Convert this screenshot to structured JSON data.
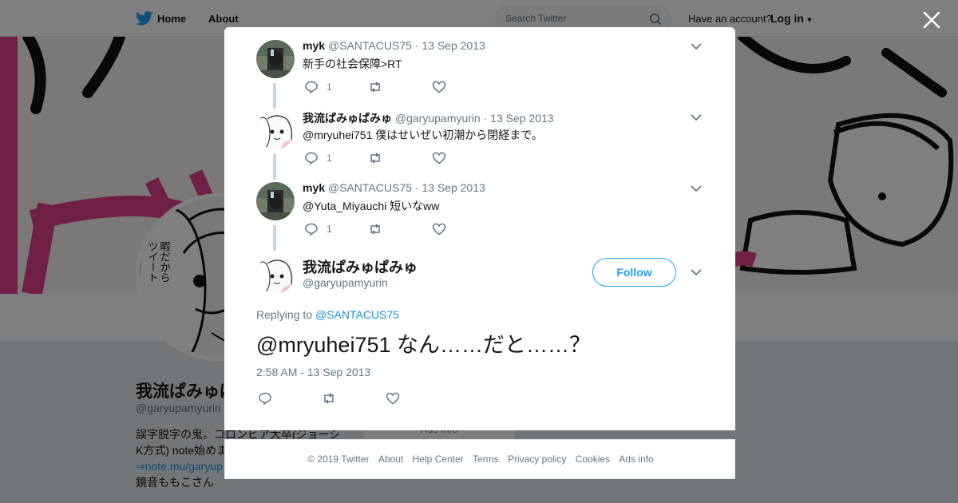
{
  "topbar": {
    "home_label": "Home",
    "about_label": "About",
    "search_placeholder": "Search Twitter",
    "have_account": "Have an account?",
    "login_label": "Log in"
  },
  "profile": {
    "name": "我流ぱみゅぱみゅ",
    "handle": "@garyupamyurin",
    "bio_line1": "誤字脱字の鬼。コロンビア大卒(ジョーシ",
    "bio_line2": "K方式) note始めま",
    "bio_link": "⇒note.mu/garyup",
    "bio_line4": "鏡音ももこさん",
    "card_text": "Ads info"
  },
  "thread": [
    {
      "name": "myk",
      "handle": "@SANTACUS75",
      "date": "13 Sep 2013",
      "text": "新手の社会保障>RT",
      "reply_count": "1",
      "avatar": "photo-avatar"
    },
    {
      "name": "我流ぱみゅぱみゅ",
      "handle": "@garyupamyurin",
      "date": "13 Sep 2013",
      "text": "@mryuhei751 僕はせいぜい初潮から閉経まで。",
      "reply_count": "1",
      "avatar": "manga-avatar"
    },
    {
      "name": "myk",
      "handle": "@SANTACUS75",
      "date": "13 Sep 2013",
      "text": "@Yuta_Miyauchi 短いなww",
      "reply_count": "1",
      "avatar": "photo-avatar"
    }
  ],
  "main_tweet": {
    "name": "我流ぱみゅぱみゅ",
    "handle": "@garyupamyurin",
    "follow_label": "Follow",
    "replying_prefix": "Replying to",
    "replying_to": "@SANTACUS75",
    "text": "@mryuhei751 なん……だと……？",
    "timestamp": "2:58 AM - 13 Sep 2013"
  },
  "footer": {
    "links": [
      "© 2019 Twitter",
      "About",
      "Help Center",
      "Terms",
      "Privacy policy",
      "Cookies",
      "Ads info"
    ]
  },
  "colors": {
    "accent": "#1da1f2",
    "link": "#1b95e0",
    "muted": "#657786",
    "thread_line": "#ccd6dd",
    "banner_pink": "#e0418a"
  }
}
